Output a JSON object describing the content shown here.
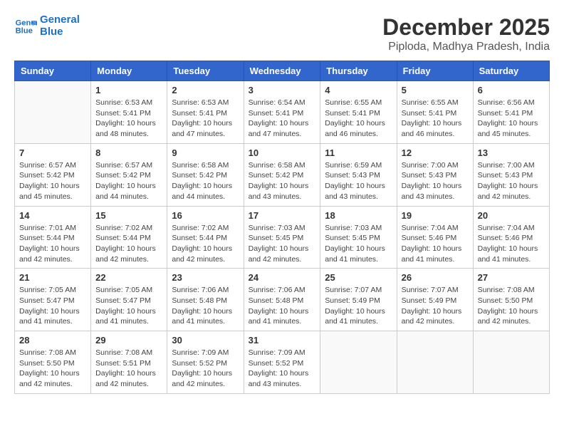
{
  "logo": {
    "line1": "General",
    "line2": "Blue"
  },
  "title": "December 2025",
  "location": "Piploda, Madhya Pradesh, India",
  "headers": [
    "Sunday",
    "Monday",
    "Tuesday",
    "Wednesday",
    "Thursday",
    "Friday",
    "Saturday"
  ],
  "weeks": [
    [
      {
        "day": "",
        "info": ""
      },
      {
        "day": "1",
        "info": "Sunrise: 6:53 AM\nSunset: 5:41 PM\nDaylight: 10 hours\nand 48 minutes."
      },
      {
        "day": "2",
        "info": "Sunrise: 6:53 AM\nSunset: 5:41 PM\nDaylight: 10 hours\nand 47 minutes."
      },
      {
        "day": "3",
        "info": "Sunrise: 6:54 AM\nSunset: 5:41 PM\nDaylight: 10 hours\nand 47 minutes."
      },
      {
        "day": "4",
        "info": "Sunrise: 6:55 AM\nSunset: 5:41 PM\nDaylight: 10 hours\nand 46 minutes."
      },
      {
        "day": "5",
        "info": "Sunrise: 6:55 AM\nSunset: 5:41 PM\nDaylight: 10 hours\nand 46 minutes."
      },
      {
        "day": "6",
        "info": "Sunrise: 6:56 AM\nSunset: 5:41 PM\nDaylight: 10 hours\nand 45 minutes."
      }
    ],
    [
      {
        "day": "7",
        "info": "Sunrise: 6:57 AM\nSunset: 5:42 PM\nDaylight: 10 hours\nand 45 minutes."
      },
      {
        "day": "8",
        "info": "Sunrise: 6:57 AM\nSunset: 5:42 PM\nDaylight: 10 hours\nand 44 minutes."
      },
      {
        "day": "9",
        "info": "Sunrise: 6:58 AM\nSunset: 5:42 PM\nDaylight: 10 hours\nand 44 minutes."
      },
      {
        "day": "10",
        "info": "Sunrise: 6:58 AM\nSunset: 5:42 PM\nDaylight: 10 hours\nand 43 minutes."
      },
      {
        "day": "11",
        "info": "Sunrise: 6:59 AM\nSunset: 5:43 PM\nDaylight: 10 hours\nand 43 minutes."
      },
      {
        "day": "12",
        "info": "Sunrise: 7:00 AM\nSunset: 5:43 PM\nDaylight: 10 hours\nand 43 minutes."
      },
      {
        "day": "13",
        "info": "Sunrise: 7:00 AM\nSunset: 5:43 PM\nDaylight: 10 hours\nand 42 minutes."
      }
    ],
    [
      {
        "day": "14",
        "info": "Sunrise: 7:01 AM\nSunset: 5:44 PM\nDaylight: 10 hours\nand 42 minutes."
      },
      {
        "day": "15",
        "info": "Sunrise: 7:02 AM\nSunset: 5:44 PM\nDaylight: 10 hours\nand 42 minutes."
      },
      {
        "day": "16",
        "info": "Sunrise: 7:02 AM\nSunset: 5:44 PM\nDaylight: 10 hours\nand 42 minutes."
      },
      {
        "day": "17",
        "info": "Sunrise: 7:03 AM\nSunset: 5:45 PM\nDaylight: 10 hours\nand 42 minutes."
      },
      {
        "day": "18",
        "info": "Sunrise: 7:03 AM\nSunset: 5:45 PM\nDaylight: 10 hours\nand 41 minutes."
      },
      {
        "day": "19",
        "info": "Sunrise: 7:04 AM\nSunset: 5:46 PM\nDaylight: 10 hours\nand 41 minutes."
      },
      {
        "day": "20",
        "info": "Sunrise: 7:04 AM\nSunset: 5:46 PM\nDaylight: 10 hours\nand 41 minutes."
      }
    ],
    [
      {
        "day": "21",
        "info": "Sunrise: 7:05 AM\nSunset: 5:47 PM\nDaylight: 10 hours\nand 41 minutes."
      },
      {
        "day": "22",
        "info": "Sunrise: 7:05 AM\nSunset: 5:47 PM\nDaylight: 10 hours\nand 41 minutes."
      },
      {
        "day": "23",
        "info": "Sunrise: 7:06 AM\nSunset: 5:48 PM\nDaylight: 10 hours\nand 41 minutes."
      },
      {
        "day": "24",
        "info": "Sunrise: 7:06 AM\nSunset: 5:48 PM\nDaylight: 10 hours\nand 41 minutes."
      },
      {
        "day": "25",
        "info": "Sunrise: 7:07 AM\nSunset: 5:49 PM\nDaylight: 10 hours\nand 41 minutes."
      },
      {
        "day": "26",
        "info": "Sunrise: 7:07 AM\nSunset: 5:49 PM\nDaylight: 10 hours\nand 42 minutes."
      },
      {
        "day": "27",
        "info": "Sunrise: 7:08 AM\nSunset: 5:50 PM\nDaylight: 10 hours\nand 42 minutes."
      }
    ],
    [
      {
        "day": "28",
        "info": "Sunrise: 7:08 AM\nSunset: 5:50 PM\nDaylight: 10 hours\nand 42 minutes."
      },
      {
        "day": "29",
        "info": "Sunrise: 7:08 AM\nSunset: 5:51 PM\nDaylight: 10 hours\nand 42 minutes."
      },
      {
        "day": "30",
        "info": "Sunrise: 7:09 AM\nSunset: 5:52 PM\nDaylight: 10 hours\nand 42 minutes."
      },
      {
        "day": "31",
        "info": "Sunrise: 7:09 AM\nSunset: 5:52 PM\nDaylight: 10 hours\nand 43 minutes."
      },
      {
        "day": "",
        "info": ""
      },
      {
        "day": "",
        "info": ""
      },
      {
        "day": "",
        "info": ""
      }
    ]
  ]
}
